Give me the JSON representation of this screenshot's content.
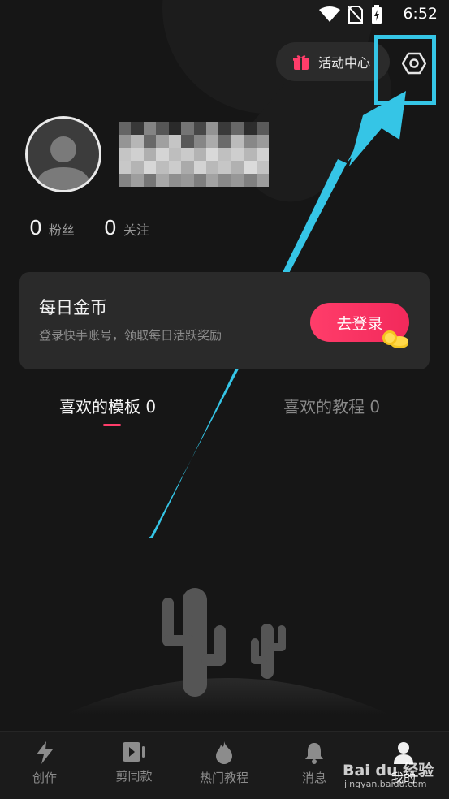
{
  "status_bar": {
    "time": "6:52"
  },
  "header": {
    "activity_label": "活动中心"
  },
  "profile": {
    "followers_count": "0",
    "followers_label": "粉丝",
    "following_count": "0",
    "following_label": "关注"
  },
  "coin_card": {
    "title": "每日金币",
    "description": "登录快手账号，领取每日活跃奖励",
    "login_button": "去登录"
  },
  "tabs": [
    {
      "label": "喜欢的模板 0",
      "active": true
    },
    {
      "label": "喜欢的教程 0",
      "active": false
    }
  ],
  "bottom_nav": [
    {
      "label": "创作",
      "icon": "lightning-icon"
    },
    {
      "label": "剪同款",
      "icon": "video-icon"
    },
    {
      "label": "热门教程",
      "icon": "flame-icon"
    },
    {
      "label": "消息",
      "icon": "bell-icon"
    },
    {
      "label": "我的",
      "icon": "person-icon",
      "active": true
    }
  ],
  "watermark": {
    "brand": "Bai du 经验",
    "url": "jingyan.baidu.com"
  },
  "colors": {
    "accent": "#ff3d6a",
    "annotation": "#35c5e6",
    "background": "#161616"
  }
}
